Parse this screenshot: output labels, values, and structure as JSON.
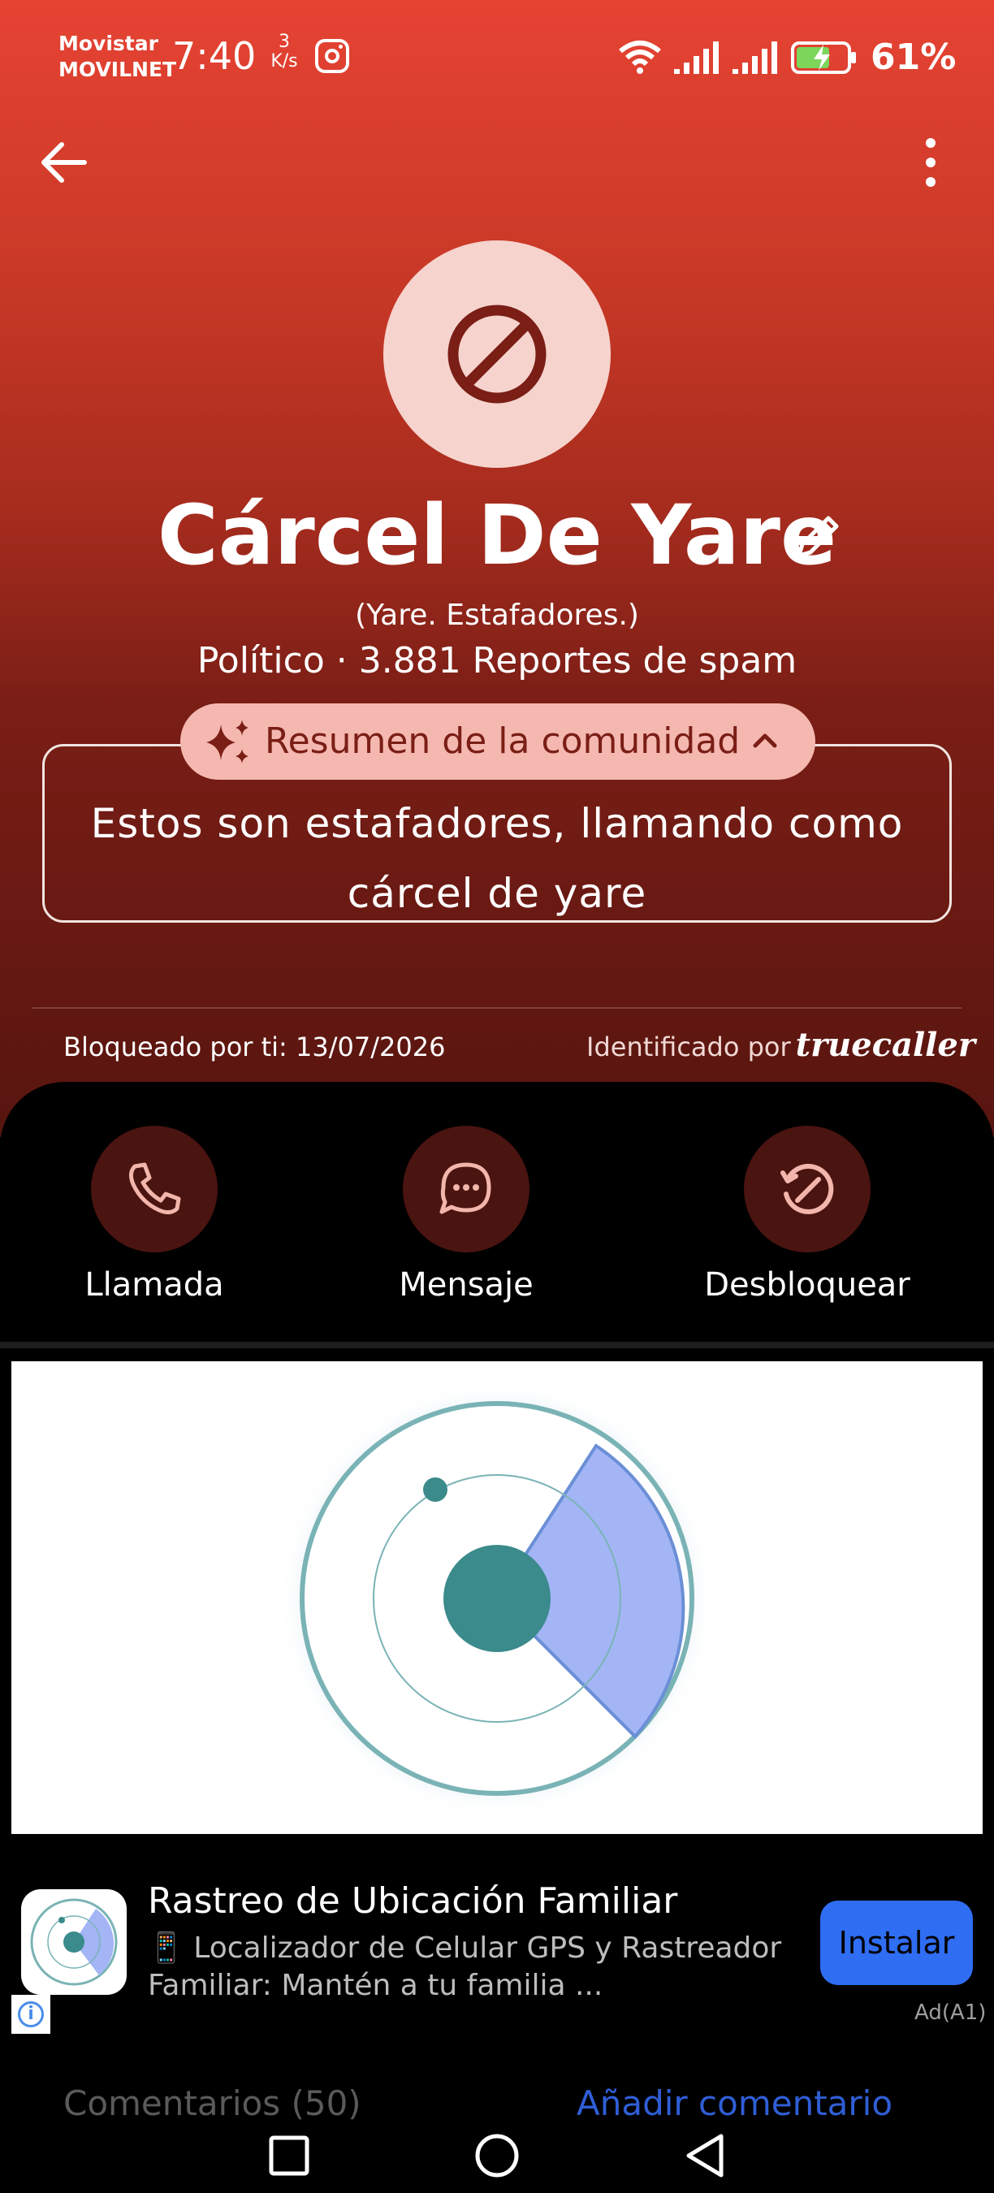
{
  "status_bar": {
    "carrier_line1": "Movistar",
    "carrier_line2": "MOVILNET",
    "time": "7:40",
    "speed_value": "3",
    "speed_unit": "K/s",
    "battery_percent": "61%"
  },
  "profile": {
    "name": "Cárcel De Yare",
    "alt_name": "(Yare. Estafadores.)",
    "category_and_reports": "Político · 3.881 Reportes de spam",
    "summary_label": "Resumen de la comunidad",
    "summary_text": "Estos son estafadores, llamando como cárcel de yare",
    "blocked_text": "Bloqueado por ti: 13/07/2026",
    "identified_by": "Identificado por",
    "identified_brand": "truecaller"
  },
  "actions": [
    {
      "label": "Llamada",
      "icon": "phone-icon"
    },
    {
      "label": "Mensaje",
      "icon": "chat-bubble-icon"
    },
    {
      "label": "Desbloquear",
      "icon": "unblock-icon"
    }
  ],
  "ad": {
    "title": "Rastreo de Ubicación Familiar",
    "description": "📱 Localizador de Celular GPS y Rastreador Familiar: Mantén a tu familia ...",
    "install_label": "Instalar",
    "ad_label": "Ad(A1)",
    "info_icon_text": "i"
  },
  "comments": {
    "count_label": "Comentarios (50)",
    "add_label": "Añadir comentario"
  },
  "colors": {
    "hero_top": "#e64333",
    "hero_bottom": "#57150f",
    "avatar_bg": "#f6d3cd",
    "summary_pill": "#f4b8b0",
    "install_button": "#2f6df2",
    "add_comment_link": "#2f5ed6"
  }
}
